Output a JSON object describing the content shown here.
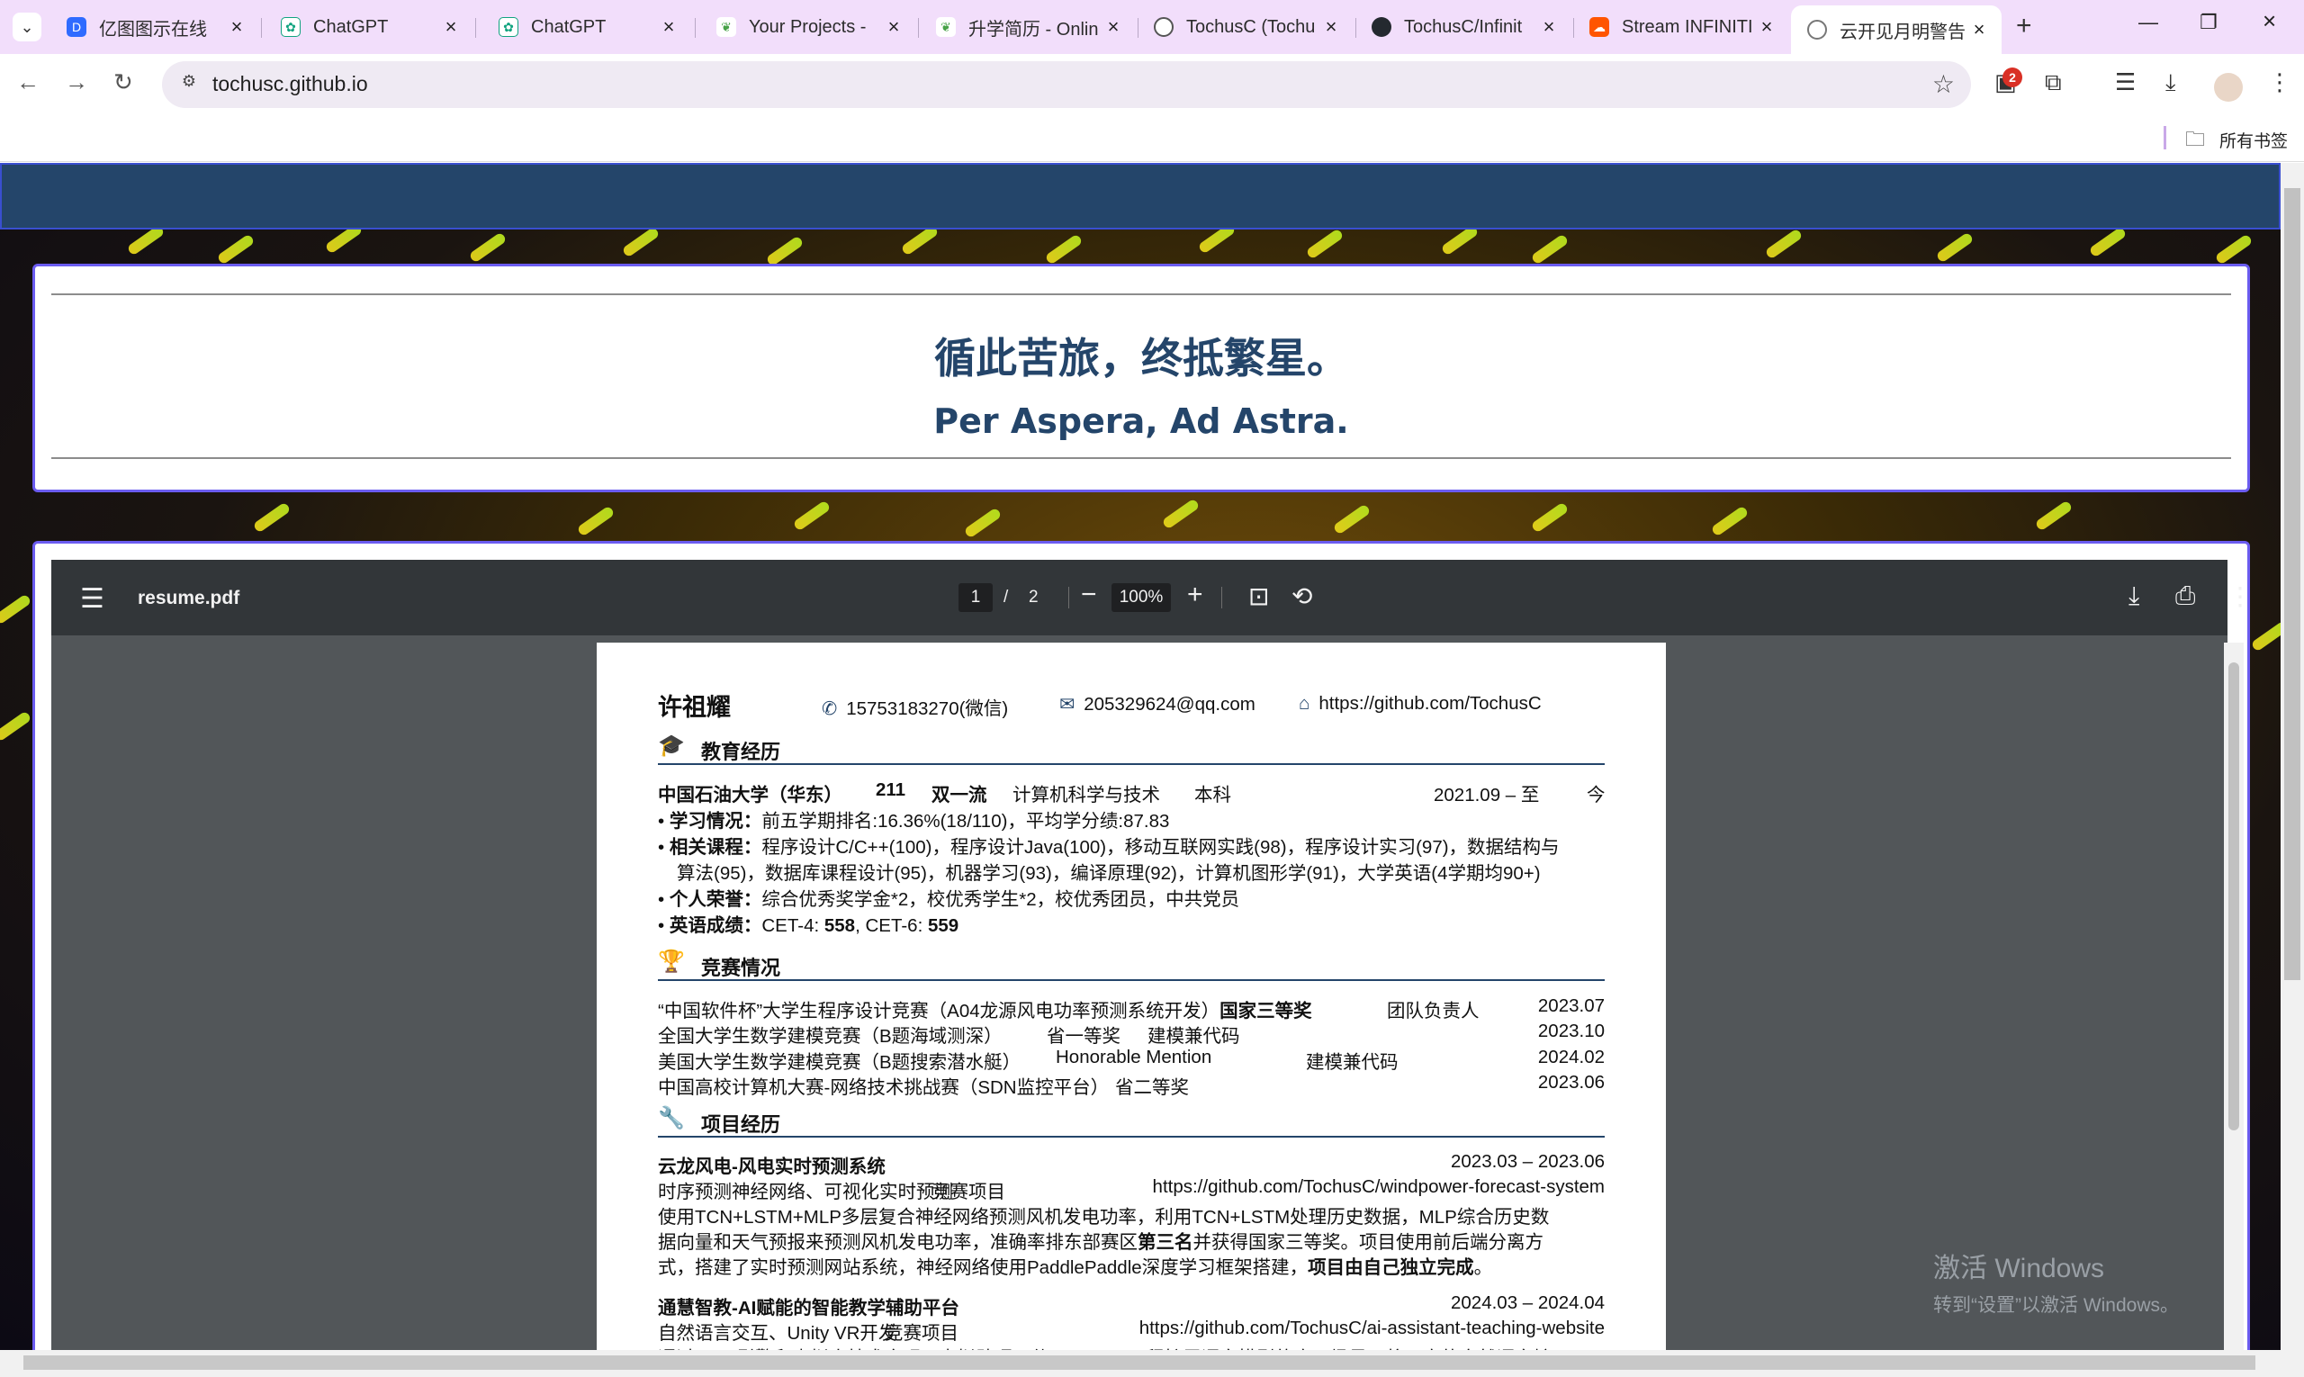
{
  "browser": {
    "tabs": [
      {
        "title": "亿图图示在线",
        "color": "#2f6bff",
        "glyph": "D",
        "active": false
      },
      {
        "title": "ChatGPT",
        "color": "#10a37f",
        "glyph": "✿",
        "active": false
      },
      {
        "title": "ChatGPT",
        "color": "#10a37f",
        "glyph": "✿",
        "active": false
      },
      {
        "title": "Your Projects - ",
        "color": "#47a248",
        "glyph": "❦",
        "active": false
      },
      {
        "title": "升学简历 - Onlin",
        "color": "#47a248",
        "glyph": "❦",
        "active": false
      },
      {
        "title": "TochusC (Tochu",
        "color": "#555555",
        "glyph": "◉",
        "active": false
      },
      {
        "title": "TochusC/Infinit",
        "color": "#24292f",
        "glyph": "◉",
        "active": false
      },
      {
        "title": "Stream INFINITI",
        "color": "#ff5500",
        "glyph": "☁",
        "active": false
      },
      {
        "title": "云开见月明警告",
        "color": "#777777",
        "glyph": "◌",
        "active": true
      }
    ],
    "url": "tochusc.github.io",
    "extension_badge": "2",
    "bookmarks_label": "所有书签"
  },
  "hero": {
    "motto_cn": "循此苦旅，终抵繁星。",
    "motto_en": "Per Aspera, Ad Astra."
  },
  "pdf_viewer": {
    "filename": "resume.pdf",
    "current_page": "1",
    "page_separator": "/",
    "total_pages": "2",
    "zoom": "100%"
  },
  "resume": {
    "name": "许祖耀",
    "phone": "15753183270(微信)",
    "email": "205329624@qq.com",
    "homepage": "https://github.com/TochusC",
    "education": {
      "title": "教育经历",
      "school": "中国石油大学（华东）",
      "tag1": "211",
      "tag2": "双一流",
      "major": "计算机科学与技术",
      "degree": "本科",
      "date_from": "2021.09 – 至",
      "date_to": "今",
      "items": [
        {
          "label": "学习情况：",
          "text": "前五学期排名:16.36%(18/110)，平均学分绩:87.83"
        },
        {
          "label": "相关课程：",
          "text": "程序设计C/C++(100)，程序设计Java(100)，移动互联网实践(98)，程序设计实习(97)，数据结构与"
        },
        {
          "label": "",
          "text": "算法(95)，数据库课程设计(95)，机器学习(93)，编译原理(92)，计算机图形学(91)，大学英语(4学期均90+)"
        },
        {
          "label": "个人荣誉：",
          "text": "综合优秀奖学金*2，校优秀学生*2，校优秀团员，中共党员"
        }
      ],
      "english": {
        "label": "英语成绩：",
        "cet4_label": "CET-4: ",
        "cet4": "558",
        "sep": ", CET-6: ",
        "cet6": "559"
      }
    },
    "competitions": {
      "title": "竞赛情况",
      "rows": [
        {
          "prefix": "“中国软件杯”大学生程序设计竞赛（A04龙源风电功率预测系统开发）",
          "award": "国家三等奖",
          "role": "团队负责人",
          "date": "2023.07"
        },
        {
          "prefix": "全国大学生数学建模竞赛（B题海域测深）",
          "award": "省一等奖",
          "role": "建模兼代码",
          "date": "2023.10"
        },
        {
          "prefix": "美国大学生数学建模竞赛（B题搜索潜水艇）",
          "award": "Honorable Mention",
          "role": "建模兼代码",
          "date": "2024.02"
        },
        {
          "prefix": "中国高校计算机大赛-网络技术挑战赛（SDN监控平台）",
          "award": "省二等奖",
          "role": "",
          "date": "2023.06"
        }
      ]
    },
    "projects": {
      "title": "项目经历",
      "p1": {
        "name": "云龙风电-风电实时预测系统",
        "date": "2023.03 – 2023.06",
        "tags": "时序预测神经网络、可视化实时预测",
        "kind": "竞赛项目",
        "link": "https://github.com/TochusC/windpower-forecast-system",
        "l1": "使用TCN+LSTM+MLP多层复合神经网络预测风机发电功率，利用TCN+LSTM处理历史数据，MLP综合历史数",
        "l2a": "据向量和天气预报来预测风机发电功率，准确率排东部赛区",
        "l2b": "第三名",
        "l2c": "并获得国家三等奖。项目使用前后端分离方",
        "l3a": "式，搭建了实时预测网站系统，神经网络使用PaddlePaddle深度学习框架搭建，",
        "l3b": "项目由自己独立完成",
        "l3c": "。"
      },
      "p2": {
        "name": "通慧智教-AI赋能的智能教学辅助平台",
        "date": "2024.03 – 2024.04",
        "tags": "自然语言交互、Unity VR开发",
        "kind": "竞赛项目",
        "link": "https://github.com/TochusC/ai-assistant-teaching-website",
        "l1": "通过Unity引擎和虚拟人技术实现AI虚拟助理，使用Prompt工程扩展语言模型的应用场景，将用户的自然语言输"
      }
    }
  },
  "watermark": {
    "line1": "激活 Windows",
    "line2": "转到“设置”以激活 Windows。"
  },
  "colors": {
    "tabbar": "#f2defb",
    "navy": "#24456a",
    "panel_border": "#6b5cf0",
    "pdf_toolbar": "#323639",
    "pdf_bg": "#525659"
  }
}
